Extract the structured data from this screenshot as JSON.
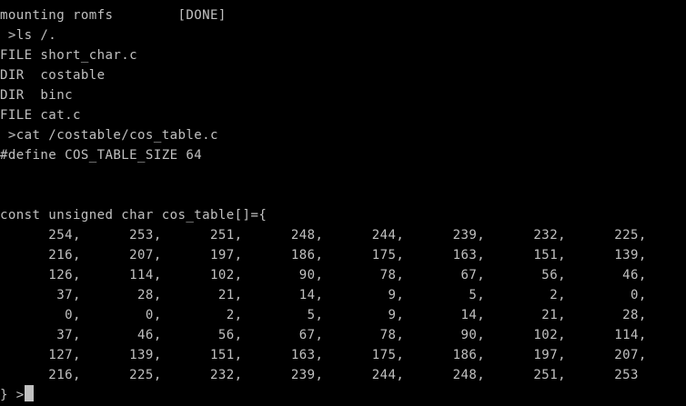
{
  "terminal": {
    "lines": [
      "mounting romfs        [DONE]",
      " >ls /.",
      "FILE short_char.c",
      "DIR  costable",
      "DIR  binc",
      "FILE cat.c",
      " >cat /costable/cos_table.c",
      "#define COS_TABLE_SIZE 64",
      "",
      "",
      "const unsigned char cos_table[]={",
      "      254,      253,      251,      248,      244,      239,      232,      225,",
      "      216,      207,      197,      186,      175,      163,      151,      139,",
      "      126,      114,      102,       90,       78,       67,       56,       46,",
      "       37,       28,       21,       14,        9,        5,        2,        0,",
      "        0,        0,        2,        5,        9,       14,       21,       28,",
      "       37,       46,       56,       67,       78,       90,      102,      114,",
      "      127,      139,      151,      163,      175,      186,      197,      207,",
      "      216,      225,      232,      239,      244,      248,      251,      253"
    ],
    "prompt": "} >",
    "colors": {
      "background": "#000000",
      "foreground": "#c0c0c0",
      "cursor": "#c0c0c0"
    }
  }
}
